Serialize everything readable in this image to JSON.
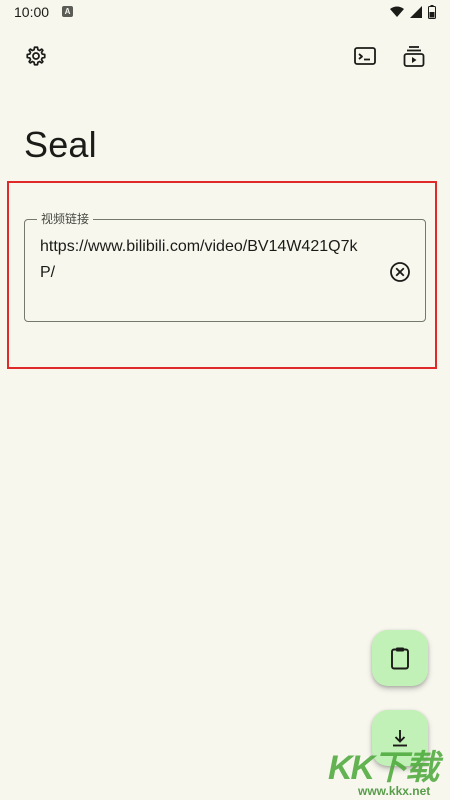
{
  "status_bar": {
    "time": "10:00",
    "notification_icon": "a-letter-icon",
    "wifi_icon": "wifi-icon",
    "signal_icon": "signal-icon",
    "battery_icon": "battery-icon"
  },
  "toolbar": {
    "settings_icon": "gear-icon",
    "terminal_icon": "terminal-icon",
    "queue_icon": "video-queue-icon"
  },
  "page": {
    "title": "Seal"
  },
  "url_field": {
    "label": "视频链接",
    "value": "https://www.bilibili.com/video/BV14W421Q7kP/",
    "clear_icon": "clear-circle-icon"
  },
  "fabs": {
    "paste_icon": "clipboard-icon",
    "download_icon": "download-icon"
  },
  "watermark": {
    "brand": "KK下载",
    "site": "www.kkx.net"
  },
  "colors": {
    "background": "#f7f7ee",
    "fab": "#c2f1b8",
    "highlight": "#e02a2a"
  }
}
